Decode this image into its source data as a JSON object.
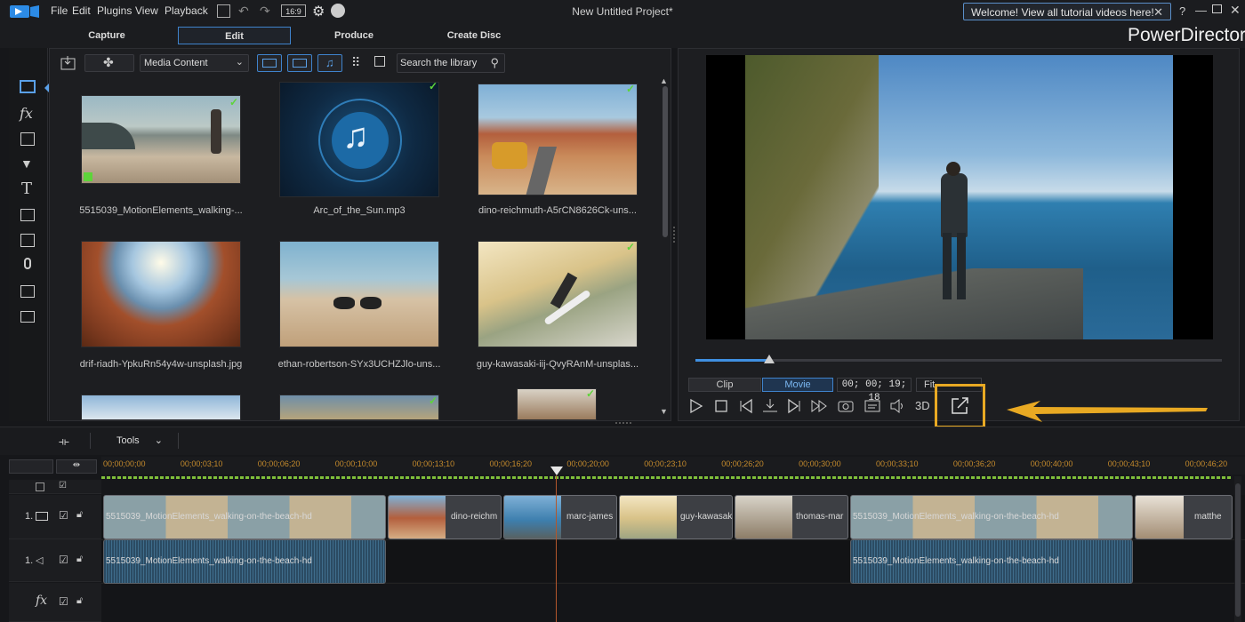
{
  "menu": {
    "items": [
      "File",
      "Edit",
      "Plugins",
      "View",
      "Playback"
    ],
    "ratio": "16:9"
  },
  "window": {
    "title": "New Untitled Project*",
    "brand": "PowerDirector"
  },
  "welcome": {
    "text": "Welcome! View all tutorial videos here!"
  },
  "tabs": [
    "Capture",
    "Edit",
    "Produce",
    "Create Disc"
  ],
  "library": {
    "dropdown": "Media Content",
    "search_placeholder": "Search the library",
    "items": [
      {
        "label": "5515039_MotionElements_walking-..."
      },
      {
        "label": "Arc_of_the_Sun.mp3"
      },
      {
        "label": "dino-reichmuth-A5rCN8626Ck-uns..."
      },
      {
        "label": "drif-riadh-YpkuRn54y4w-unsplash.jpg"
      },
      {
        "label": "ethan-robertson-SYx3UCHZJlo-uns..."
      },
      {
        "label": "guy-kawasaki-iij-QvyRAnM-unsplas..."
      }
    ]
  },
  "preview": {
    "clip_tab": "Clip",
    "movie_tab": "Movie",
    "timecode": "00; 00; 19; 18",
    "fit": "Fit",
    "three_d": "3D",
    "progress": 0.14
  },
  "timeline": {
    "tools_label": "Tools",
    "ruler": [
      "00;00;00;00",
      "00;00;03;10",
      "00;00;06;20",
      "00;00;10;00",
      "00;00;13;10",
      "00;00;16;20",
      "00;00;20;00",
      "00;00;23;10",
      "00;00;26;20",
      "00;00;30;00",
      "00;00;33;10",
      "00;00;36;20",
      "00;00;40;00",
      "00;00;43;10",
      "00;00;46;20"
    ],
    "track_numbers": [
      "1.",
      "1."
    ],
    "video_clips": [
      "5515039_MotionElements_walking-on-the-beach-hd",
      "dino-reichm",
      "marc-james",
      "guy-kawasak",
      "thomas-mar",
      "5515039_MotionElements_walking-on-the-beach-hd",
      "matthe"
    ],
    "audio_clips": [
      "5515039_MotionElements_walking-on-the-beach-hd",
      "5515039_MotionElements_walking-on-the-beach-hd"
    ],
    "fx_label": "fx"
  },
  "colors": {
    "accent": "#3f83cc",
    "highlight": "#e8a923",
    "ruler": "#c48a2c",
    "check": "#5ed43a"
  }
}
